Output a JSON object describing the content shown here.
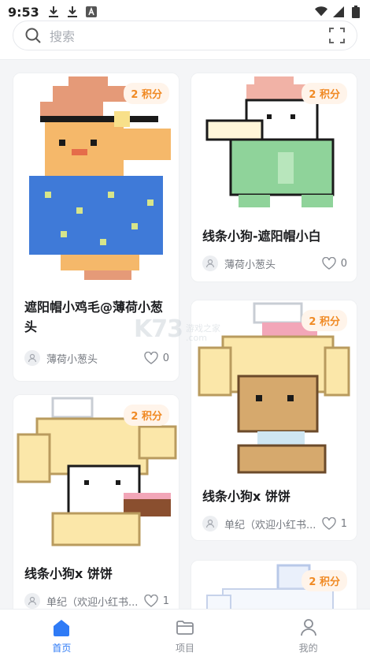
{
  "status_bar": {
    "time": "9:53",
    "icons": [
      "download-icon",
      "download-icon",
      "a-badge-icon",
      "wifi-icon",
      "signal-icon",
      "battery-icon"
    ]
  },
  "search": {
    "placeholder": "搜索",
    "icons": [
      "search-icon",
      "scan-icon"
    ]
  },
  "cards": [
    {
      "id": "c1",
      "points": "2 积分",
      "title": "遮阳帽小鸡毛@薄荷小葱头",
      "author": "薄荷小葱头",
      "likes": "0"
    },
    {
      "id": "c2",
      "points": "2 积分",
      "title": "线条小狗-遮阳帽小白",
      "author": "薄荷小葱头",
      "likes": "0"
    },
    {
      "id": "c3",
      "points": "2 积分",
      "title": "线条小狗x 饼饼",
      "author": "单纪（欢迎小红书...",
      "likes": "1"
    },
    {
      "id": "c4",
      "points": "2 积分",
      "title": "线条小狗x 饼饼",
      "author": "单纪（欢迎小红书...",
      "likes": "1"
    },
    {
      "id": "c5",
      "points": "2 积分"
    }
  ],
  "watermark": {
    "logo": "K73",
    "line1": "游戏之家",
    "line2": ".com"
  },
  "nav": {
    "items": [
      {
        "label": "首页",
        "icon": "home-icon",
        "active": true
      },
      {
        "label": "项目",
        "icon": "folder-icon",
        "active": false
      },
      {
        "label": "我的",
        "icon": "user-icon",
        "active": false
      }
    ]
  },
  "colors": {
    "accent": "#2f7bf6",
    "badge_text": "#f08a24",
    "badge_bg": "#fff4ea"
  }
}
